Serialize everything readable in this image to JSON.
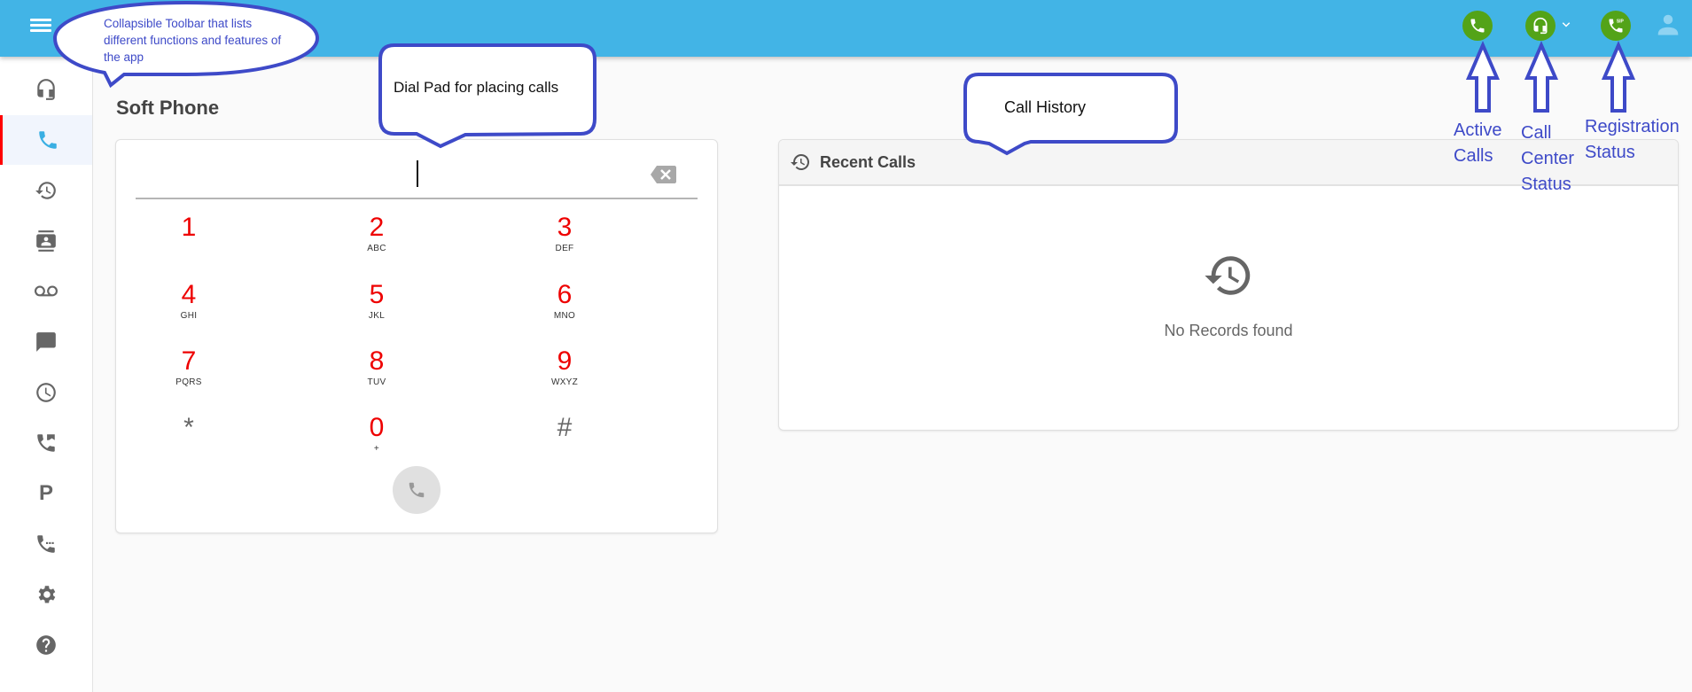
{
  "header": {
    "menu_icon": "hamburger-menu-icon",
    "status_icons": [
      {
        "name": "active-calls",
        "icon": "phone-icon",
        "color": "#53a318"
      },
      {
        "name": "call-center-status",
        "icon": "headset-icon",
        "color": "#53a318",
        "has_dropdown": true
      },
      {
        "name": "registration-status",
        "icon": "sip-phone-icon",
        "color": "#53a318"
      },
      {
        "name": "user-profile",
        "icon": "user-icon"
      }
    ],
    "background_color": "#42b4e6"
  },
  "sidebar": {
    "items": [
      {
        "id": "call-center",
        "icon": "headset-icon"
      },
      {
        "id": "soft-phone",
        "icon": "phone-icon",
        "active": true
      },
      {
        "id": "call-history",
        "icon": "history-icon"
      },
      {
        "id": "contacts",
        "icon": "contact-card-icon"
      },
      {
        "id": "voicemail",
        "icon": "voicemail-icon"
      },
      {
        "id": "messages",
        "icon": "chat-icon"
      },
      {
        "id": "schedule",
        "icon": "clock-icon"
      },
      {
        "id": "call-forwarding",
        "icon": "forwarded-call-icon"
      },
      {
        "id": "parking",
        "icon": "parking-icon",
        "label": "P"
      },
      {
        "id": "call-waiting",
        "icon": "call-waiting-icon"
      },
      {
        "id": "settings",
        "icon": "gear-icon"
      },
      {
        "id": "help",
        "icon": "help-icon"
      }
    ],
    "active_indicator_color": "#ff0000"
  },
  "main": {
    "page_title": "Soft Phone",
    "dialpad": {
      "input_value": "",
      "keys": [
        {
          "digit": "1",
          "letters": ""
        },
        {
          "digit": "2",
          "letters": "ABC"
        },
        {
          "digit": "3",
          "letters": "DEF"
        },
        {
          "digit": "4",
          "letters": "GHI"
        },
        {
          "digit": "5",
          "letters": "JKL"
        },
        {
          "digit": "6",
          "letters": "MNO"
        },
        {
          "digit": "7",
          "letters": "PQRS"
        },
        {
          "digit": "8",
          "letters": "TUV"
        },
        {
          "digit": "9",
          "letters": "WXYZ"
        },
        {
          "digit": "*",
          "letters": ""
        },
        {
          "digit": "0",
          "letters": "+"
        },
        {
          "digit": "#",
          "letters": ""
        }
      ],
      "digit_color": "#ee0000"
    },
    "recent_calls": {
      "title": "Recent Calls",
      "empty_message": "No Records found"
    }
  },
  "annotations": {
    "toolbar": "Collapsible Toolbar that lists different functions and features of the app",
    "dialpad": "Dial Pad for placing calls",
    "call_history": "Call History",
    "active_calls": [
      "Active",
      "Calls"
    ],
    "call_center_status": [
      "Call",
      "Center",
      "Status"
    ],
    "registration_status": [
      "Registration",
      "Status"
    ],
    "color": "#3e4ac8"
  }
}
